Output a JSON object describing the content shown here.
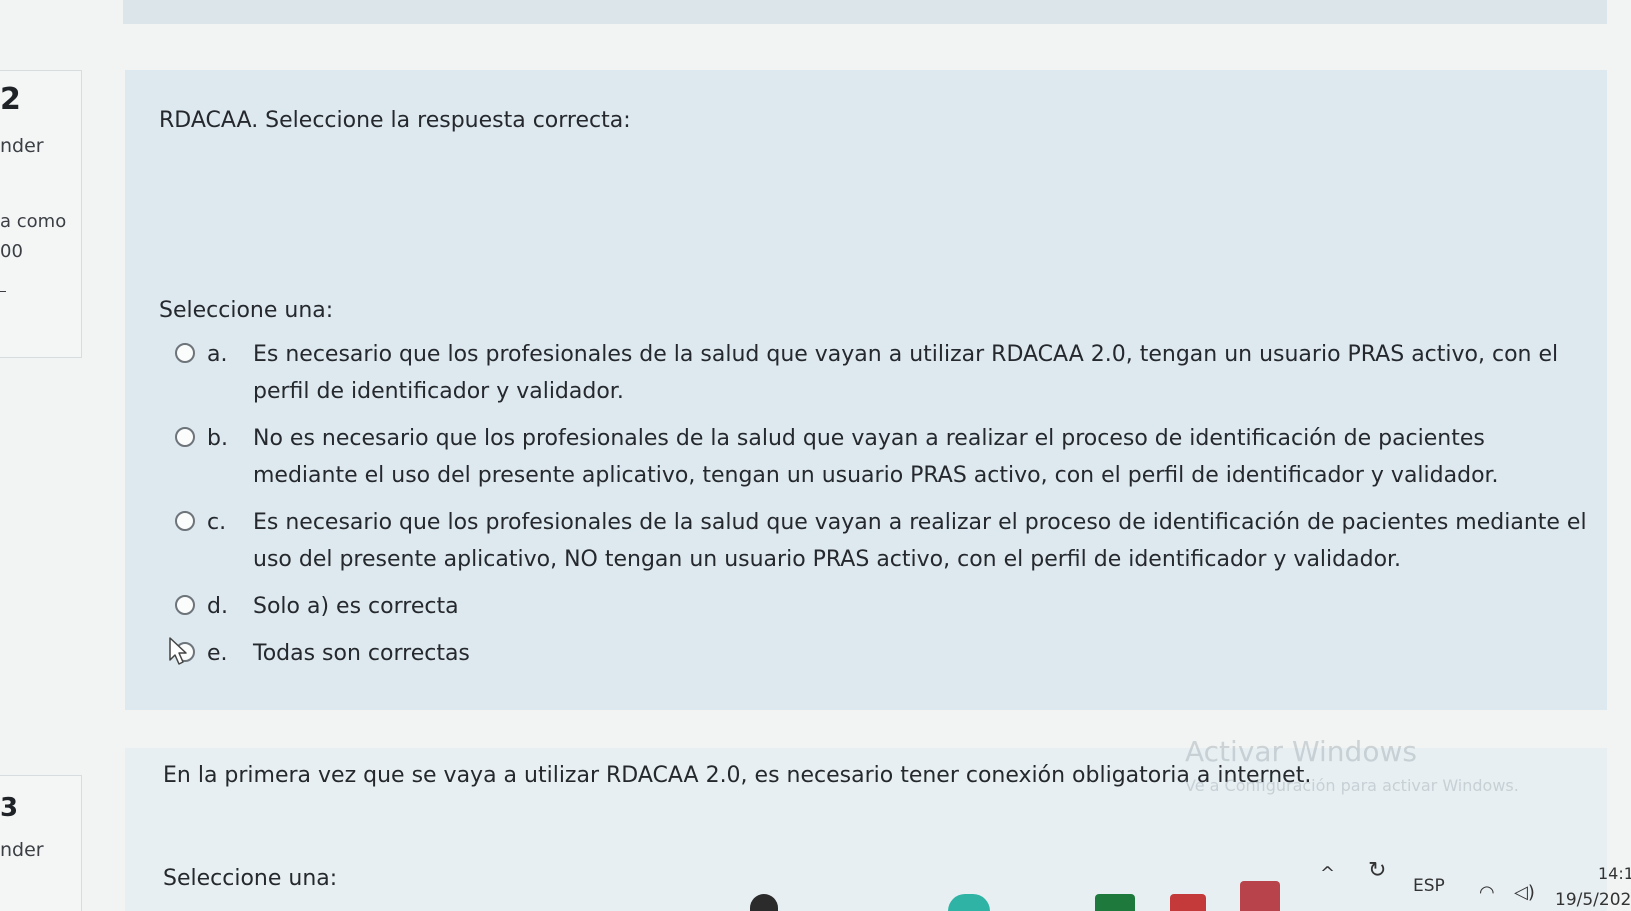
{
  "question2": {
    "number": "2",
    "status": "nder",
    "mark_label": "a como",
    "mark_value": "00",
    "question_text": "RDACAA. Seleccione la respuesta correcta:",
    "select_label": "Seleccione una:",
    "options": [
      {
        "letter": "a.",
        "text": "Es necesario que los profesionales de la salud que vayan a utilizar RDACAA 2.0, tengan un usuario PRAS activo, con el perfil de identificador y validador."
      },
      {
        "letter": "b.",
        "text": "No es necesario que los profesionales de la salud que vayan a realizar el proceso de identificación de pacientes mediante el uso del presente aplicativo, tengan un usuario PRAS activo, con el perfil de identificador y validador."
      },
      {
        "letter": "c.",
        "text": "Es necesario que los profesionales de la salud que vayan a realizar el proceso de identificación de pacientes mediante el uso del presente aplicativo, NO tengan un usuario PRAS activo, con el perfil de identificador y validador."
      },
      {
        "letter": "d.",
        "text": "Solo a) es correcta"
      },
      {
        "letter": "e.",
        "text": "Todas son correctas"
      }
    ]
  },
  "question3": {
    "number": "3",
    "status": "nder",
    "question_text": "En la primera vez que se vaya a utilizar RDACAA 2.0, es necesario tener conexión obligatoria a internet.",
    "select_label": "Seleccione una:"
  },
  "watermark": {
    "title": "Activar Windows",
    "subtitle": "Ve a Configuración para activar Windows."
  },
  "taskbar": {
    "language": "ESP",
    "time": "14:1",
    "date": "19/5/202"
  },
  "icons": {
    "cursor": "mouse-pointer-icon",
    "chevron": "chevron-up-icon",
    "wifi": "wifi-icon",
    "volume": "volume-icon"
  }
}
